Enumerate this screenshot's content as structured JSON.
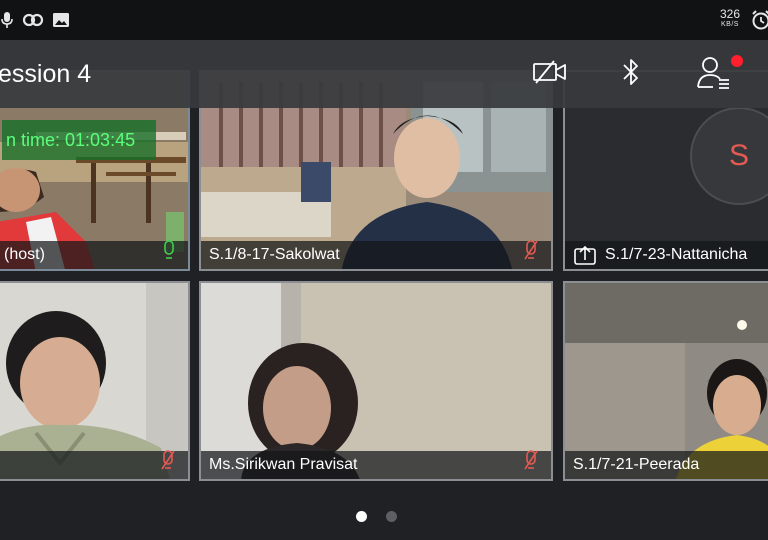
{
  "status_bar": {
    "icons": [
      "microphone-icon",
      "link-icon",
      "image-icon"
    ],
    "net_speed": "326",
    "net_speed_unit": "KB/S",
    "alarm_icon": "alarm-clock-icon"
  },
  "meeting": {
    "title": "ession 4",
    "toolbar": [
      "video-off-icon",
      "bluetooth-icon",
      "participants-icon"
    ],
    "has_notification": true
  },
  "timer_label": "n time: 01:03:45",
  "tiles": [
    {
      "name": "(host)",
      "mic": "on"
    },
    {
      "name": "S.1/8-17-Sakolwat",
      "mic": "muted"
    },
    {
      "name": "S.1/7-23-Nattanicha",
      "mic": "none",
      "screen_share_icon": "share-screen-icon",
      "avatar_letter": "S"
    },
    {
      "name": "",
      "mic": "muted"
    },
    {
      "name": "Ms.Sirikwan Pravisat",
      "mic": "muted"
    },
    {
      "name": "S.1/7-21-Peerada",
      "mic": "none"
    }
  ],
  "pager": {
    "pages": 2,
    "active": 1
  },
  "colors": {
    "status_bar": "#111213",
    "top_bar": "#37393d",
    "timer_bg": "#146e28",
    "timer_text": "#5aff7a",
    "mic_on": "#3fcf4f",
    "mic_muted": "#e35a52",
    "avatar_letter": "#e35a52",
    "notification": "#ff1f2d"
  }
}
